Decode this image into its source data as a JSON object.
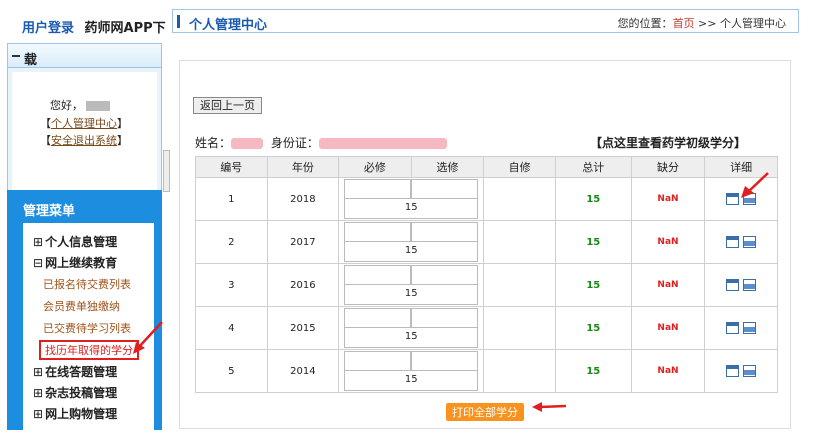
{
  "top_links": {
    "login": "用户登录",
    "app": "药师网APP下"
  },
  "header": {
    "title": "个人管理中心",
    "pos_label": "您的位置：",
    "home": "首页",
    "sep": " >> ",
    "current": "个人管理中心"
  },
  "login_box": {
    "title": "载",
    "hello": "您好，",
    "personal_link": "个人管理中心",
    "logout_link": "安全退出系统"
  },
  "menu": {
    "title": "管理菜单",
    "items": [
      {
        "label": "个人信息管理"
      },
      {
        "label": "网上继续教育"
      },
      {
        "label": "在线答题管理"
      },
      {
        "label": "杂志投稿管理"
      },
      {
        "label": "网上购物管理"
      }
    ],
    "subitems": [
      "已报名待交费列表",
      "会员费单独缴纳",
      "已交费待学习列表",
      "找历年取得的学分"
    ]
  },
  "content": {
    "back_button": "返回上一页",
    "name_label": "姓名：",
    "id_label": "身份证：",
    "view_link": "【点这里查看药学初级学分】",
    "print_all": "打印全部学分"
  },
  "table": {
    "headers": [
      "编号",
      "年份",
      "必修",
      "选修",
      "自修",
      "总计",
      "缺分",
      "详细"
    ],
    "rows": [
      {
        "no": "1",
        "year": "2018",
        "sub": "15",
        "total": "15",
        "missing": "NaN"
      },
      {
        "no": "2",
        "year": "2017",
        "sub": "15",
        "total": "15",
        "missing": "NaN"
      },
      {
        "no": "3",
        "year": "2016",
        "sub": "15",
        "total": "15",
        "missing": "NaN"
      },
      {
        "no": "4",
        "year": "2015",
        "sub": "15",
        "total": "15",
        "missing": "NaN"
      },
      {
        "no": "5",
        "year": "2014",
        "sub": "15",
        "total": "15",
        "missing": "NaN"
      }
    ]
  },
  "icons": {
    "detail": "calendar-icon",
    "print": "printer-icon"
  },
  "colors": {
    "accent": "#1a5bb0",
    "menu_bg": "#1d8ddf",
    "highlight": "#e02020",
    "total": "#1a8a1a",
    "print_btn": "#f7931e"
  }
}
